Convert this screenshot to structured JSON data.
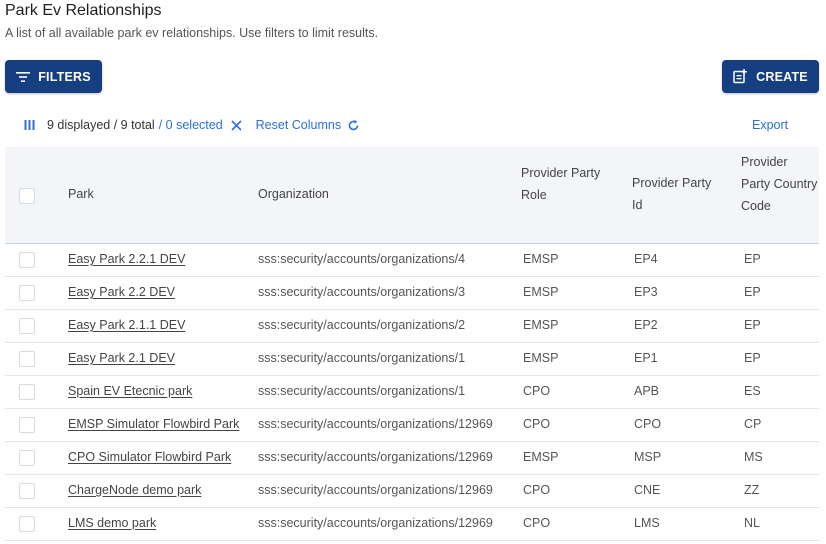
{
  "page": {
    "title": "Park Ev Relationships",
    "subtitle": "A list of all available park ev relationships. Use filters to limit results."
  },
  "buttons": {
    "filters_label": "FILTERS",
    "create_label": "CREATE"
  },
  "toolbar": {
    "counts": "9 displayed / 9 total",
    "selected": "/ 0 selected",
    "reset_columns": "Reset Columns",
    "export": "Export"
  },
  "table": {
    "headers": {
      "park": "Park",
      "organization": "Organization",
      "provider_party_role": "Provider Party Role",
      "provider_party_id": "Provider Party Id",
      "provider_party_country_code": "Provider Party Country Code"
    },
    "rows": [
      {
        "park": "Easy Park 2.2.1 DEV",
        "organization": "sss:security/accounts/organizations/4",
        "role": "EMSP",
        "party_id": "EP4",
        "country": "EP"
      },
      {
        "park": "Easy Park 2.2 DEV",
        "organization": "sss:security/accounts/organizations/3",
        "role": "EMSP",
        "party_id": "EP3",
        "country": "EP"
      },
      {
        "park": "Easy Park 2.1.1 DEV",
        "organization": "sss:security/accounts/organizations/2",
        "role": "EMSP",
        "party_id": "EP2",
        "country": "EP"
      },
      {
        "park": "Easy Park 2.1 DEV",
        "organization": "sss:security/accounts/organizations/1",
        "role": "EMSP",
        "party_id": "EP1",
        "country": "EP"
      },
      {
        "park": "Spain EV Etecnic park",
        "organization": "sss:security/accounts/organizations/1",
        "role": "CPO",
        "party_id": "APB",
        "country": "ES"
      },
      {
        "park": "EMSP Simulator Flowbird Park",
        "organization": "sss:security/accounts/organizations/12969",
        "role": "CPO",
        "party_id": "CPO",
        "country": "CP"
      },
      {
        "park": "CPO Simulator Flowbird Park",
        "organization": "sss:security/accounts/organizations/12969",
        "role": "EMSP",
        "party_id": "MSP",
        "country": "MS"
      },
      {
        "park": "ChargeNode demo park",
        "organization": "sss:security/accounts/organizations/12969",
        "role": "CPO",
        "party_id": "CNE",
        "country": "ZZ"
      },
      {
        "park": "LMS demo park",
        "organization": "sss:security/accounts/organizations/12969",
        "role": "CPO",
        "party_id": "LMS",
        "country": "NL"
      }
    ]
  },
  "icons": {
    "filters": "filter-lines-icon",
    "create": "add-document-icon",
    "columns": "columns-icon",
    "clear": "close-icon",
    "reset": "refresh-icon"
  },
  "colors": {
    "primary": "#163f82",
    "link": "#2e6fd8",
    "header_bg": "#f3f5f9"
  }
}
